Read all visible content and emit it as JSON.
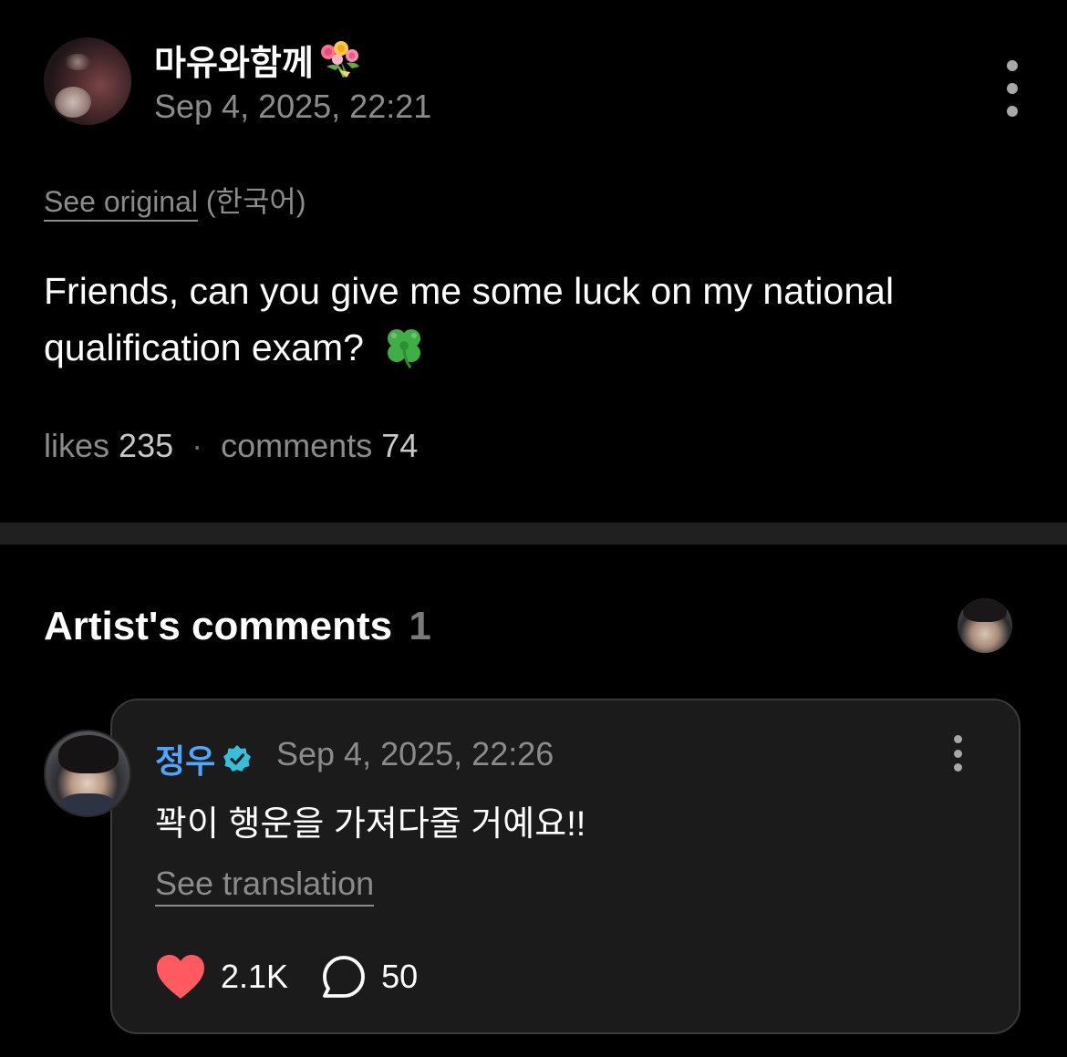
{
  "post": {
    "username": "마유와함께",
    "username_icon": "bouquet-icon",
    "date": "Sep 4, 2025, 22:21",
    "see_original_link": "See original",
    "see_original_lang": "(한국어)",
    "body": "Friends, can you give me some luck on my national qualification exam?",
    "body_icon": "four-leaf-clover-icon",
    "stats": {
      "likes_label": "likes",
      "likes_value": "235",
      "separator": "·",
      "comments_label": "comments",
      "comments_value": "74"
    }
  },
  "artist_comments": {
    "title": "Artist's comments",
    "count": "1",
    "comment": {
      "author": "정우",
      "verified_icon": "verified-badge-icon",
      "date": "Sep 4, 2025, 22:26",
      "text": "꽉이 행운을 가져다줄 거예요!!",
      "see_translation": "See translation",
      "like_count": "2.1K",
      "reply_count": "50"
    }
  },
  "colors": {
    "background": "#000000",
    "card": "#1b1b1b",
    "muted_text": "#8b8b8b",
    "artist_name": "#4da7ff",
    "heart": "#ff5a5f"
  }
}
